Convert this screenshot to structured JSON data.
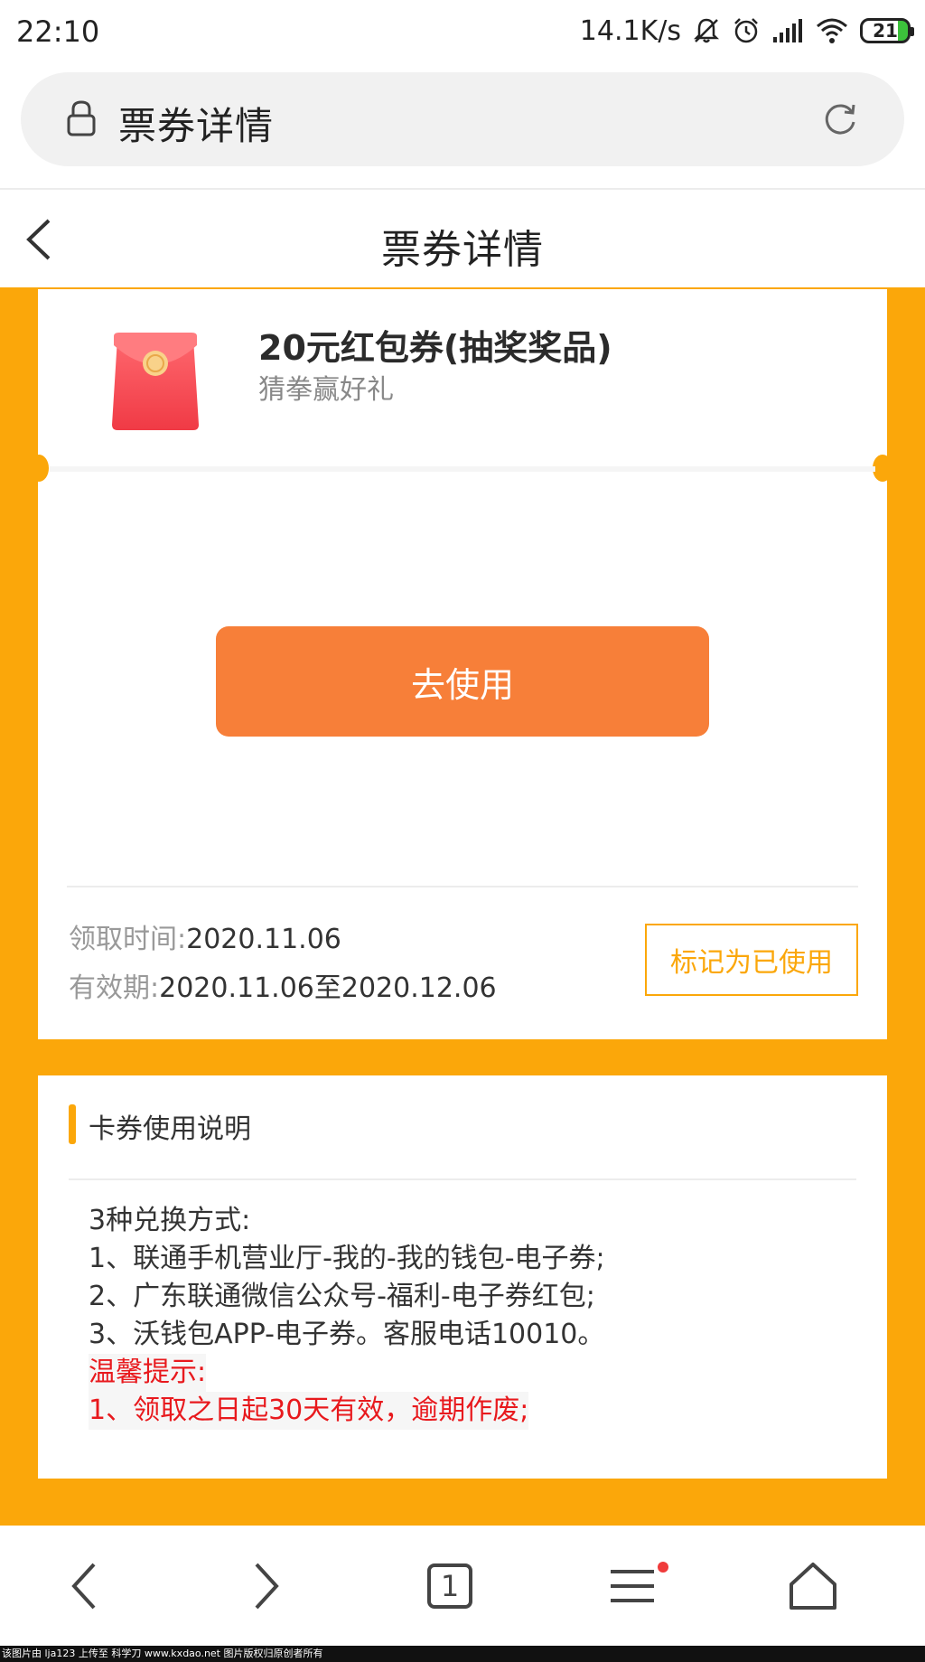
{
  "status_bar": {
    "time": "22:10",
    "network_speed": "14.1K/s",
    "battery": "21",
    "icons": [
      "bell-off-icon",
      "alarm-icon",
      "signal-icon",
      "wifi-icon",
      "battery-icon"
    ]
  },
  "browser": {
    "url_title": "票券详情",
    "icons": [
      "lock-icon",
      "reload-icon"
    ]
  },
  "header": {
    "title": "票券详情"
  },
  "coupon": {
    "name": "20元红包券(抽奖奖品)",
    "subtitle": "猜拳赢好礼",
    "use_button": "去使用",
    "receive_label": "领取时间:",
    "receive_value": "2020.11.06",
    "validity_label": "有效期:",
    "validity_value": "2020.11.06至2020.12.06",
    "mark_used_button": "标记为已使用"
  },
  "instructions": {
    "title": "卡券使用说明",
    "lines": [
      "3种兑换方式:",
      "1、联通手机营业厅-我的-我的钱包-电子券;",
      "2、广东联通微信公众号-福利-电子券红包;",
      "3、沃钱包APP-电子券。客服电话10010。"
    ],
    "tip_title": "温馨提示:",
    "tip_lines": [
      "1、领取之日起30天有效，逾期作废;"
    ]
  },
  "bottom_nav": {
    "tab_count": "1",
    "items": [
      "back-icon",
      "forward-icon",
      "tabs-icon",
      "menu-icon",
      "home-icon"
    ]
  },
  "watermark": "该图片由 lja123 上传至 科学刀 www.kxdao.net 图片版权归原创者所有",
  "colors": {
    "accent": "#fba70a",
    "button": "#f77f39",
    "warning_text": "#e8191d",
    "envelope": "#f34a52"
  }
}
